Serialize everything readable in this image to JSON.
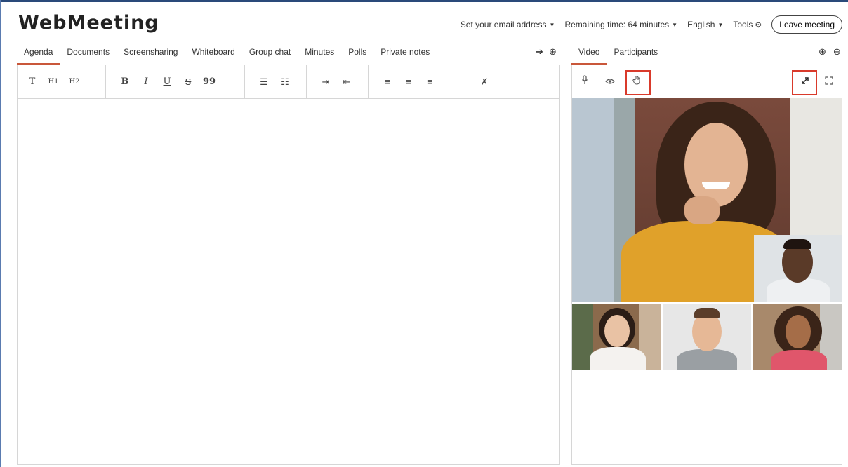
{
  "header": {
    "logo": "WebMeeting",
    "email_label": "Set your email address",
    "remaining_time": "Remaining time: 64 minutes",
    "language": "English",
    "tools_label": "Tools",
    "leave_label": "Leave meeting"
  },
  "left_tabs": [
    "Agenda",
    "Documents",
    "Screensharing",
    "Whiteboard",
    "Group chat",
    "Minutes",
    "Polls",
    "Private notes"
  ],
  "right_tabs": [
    "Video",
    "Participants"
  ],
  "toolbar": {
    "text": "T",
    "h1": "H1",
    "h2": "H2",
    "bold": "B",
    "italic": "I",
    "underline": "U",
    "strike": "S",
    "quote": "99"
  },
  "colors": {
    "accent": "#c9573a",
    "highlight": "#d93a2b",
    "top_edge": "#2a4a7a",
    "border": "#d6d6d6"
  },
  "icons": {
    "left_tab_actions": [
      "arrow-circle-right-icon",
      "plus-circle-icon"
    ],
    "right_tab_actions": [
      "plus-circle-icon",
      "minus-circle-icon"
    ],
    "video_toolbar": [
      "microphone-icon",
      "eye-icon",
      "raise-hand-icon",
      "expand-icon",
      "fullscreen-icon"
    ]
  }
}
